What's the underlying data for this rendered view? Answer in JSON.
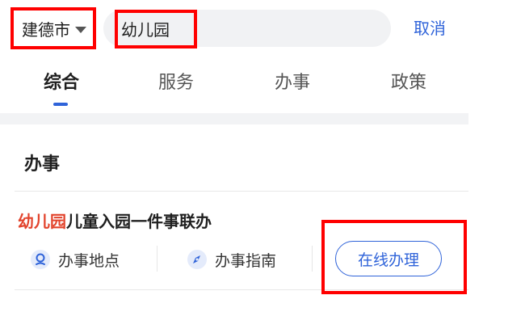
{
  "search": {
    "city": "建德市",
    "query": "幼儿园",
    "cancel_label": "取消"
  },
  "tabs": [
    {
      "label": "综合",
      "active": true
    },
    {
      "label": "服务",
      "active": false
    },
    {
      "label": "办事",
      "active": false
    },
    {
      "label": "政策",
      "active": false
    }
  ],
  "section": {
    "title": "办事"
  },
  "result": {
    "title_keyword": "幼儿园",
    "title_rest": "儿童入园一件事联办",
    "actions": [
      {
        "label": "办事地点",
        "icon": "location-pin-icon"
      },
      {
        "label": "办事指南",
        "icon": "compass-icon"
      }
    ],
    "online_label": "在线办理"
  },
  "colors": {
    "accent": "#2f63d9",
    "highlight_keyword": "#e2432c",
    "annotation_box": "#ff0000"
  }
}
